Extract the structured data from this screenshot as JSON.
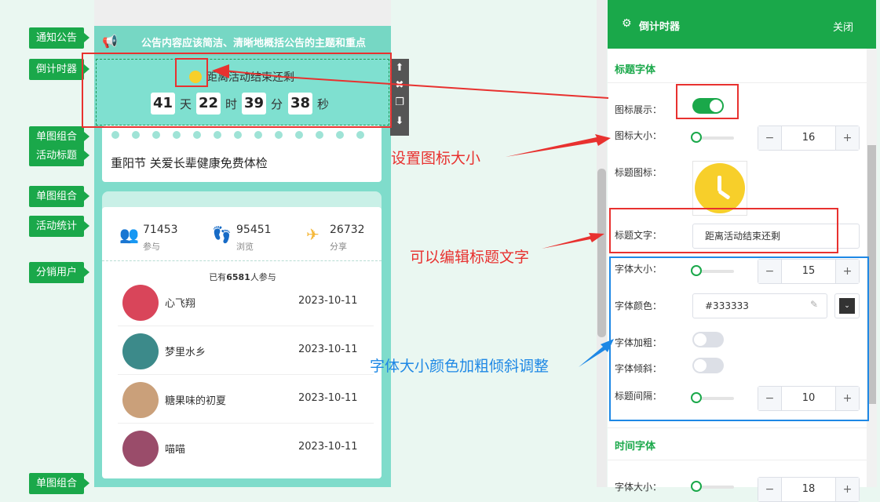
{
  "left_labels": [
    "通知公告",
    "倒计时器",
    "单图组合",
    "活动标题",
    "单图组合",
    "活动统计",
    "分销用户",
    "单图组合"
  ],
  "notice": {
    "text": "公告内容应该简洁、清晰地概括公告的主题和重点"
  },
  "countdown": {
    "title": "距离活动结束还剩",
    "days": "41",
    "days_unit": "天",
    "hours": "22",
    "hours_unit": "时",
    "minutes": "39",
    "minutes_unit": "分",
    "seconds": "38",
    "seconds_unit": "秒"
  },
  "toolbar": {
    "up": "⬆",
    "delete": "✖",
    "copy": "❐",
    "down": "⬇"
  },
  "banner": {
    "title": "重阳节 关爱长辈健康免费体检"
  },
  "stats": [
    {
      "value": "71453",
      "label": "参与",
      "icon": "users-icon",
      "color": "#7ea7f2"
    },
    {
      "value": "95451",
      "label": "浏览",
      "icon": "footprint-icon",
      "color": "#f27ca6"
    },
    {
      "value": "26732",
      "label": "分享",
      "icon": "paper-plane-icon",
      "color": "#f5b83a"
    }
  ],
  "participants": {
    "prefix": "已有",
    "count": "6581",
    "suffix": "人参与"
  },
  "users": [
    {
      "name": "心飞翔",
      "date": "2023-10-11",
      "color": "#d9455a"
    },
    {
      "name": "梦里水乡",
      "date": "2023-10-11",
      "color": "#3c8a8a"
    },
    {
      "name": "糖果味的初夏",
      "date": "2023-10-11",
      "color": "#caa07a"
    },
    {
      "name": "喵喵",
      "date": "2023-10-11",
      "color": "#9a4c6a"
    }
  ],
  "annotations": {
    "icon_size": "设置图标大小",
    "title_text": "可以编辑标题文字",
    "font_style": "字体大小颜色加粗倾斜调整"
  },
  "panel": {
    "title": "倒计时器",
    "close": "关闭",
    "section_title_font": "标题字体",
    "icon_display_label": "图标展示：",
    "icon_display_on": true,
    "icon_size_label": "图标大小：",
    "icon_size_value": "16",
    "title_icon_label": "标题图标：",
    "title_text_label": "标题文字：",
    "title_text_value": "距离活动结束还剩",
    "font_size_label": "字体大小：",
    "font_size_value": "15",
    "font_color_label": "字体颜色：",
    "font_color_value": "#333333",
    "bold_label": "字体加粗：",
    "bold_on": false,
    "italic_label": "字体倾斜：",
    "italic_on": false,
    "spacing_label": "标题间隔：",
    "spacing_value": "10",
    "section_time_font": "时间字体",
    "time_font_size_label": "字体大小：",
    "time_font_size_value": "18",
    "minus": "−",
    "plus": "+"
  },
  "colors": {
    "brand": "#1aa84a",
    "annotation_red": "#e8312f",
    "annotation_blue": "#1e88e5"
  }
}
